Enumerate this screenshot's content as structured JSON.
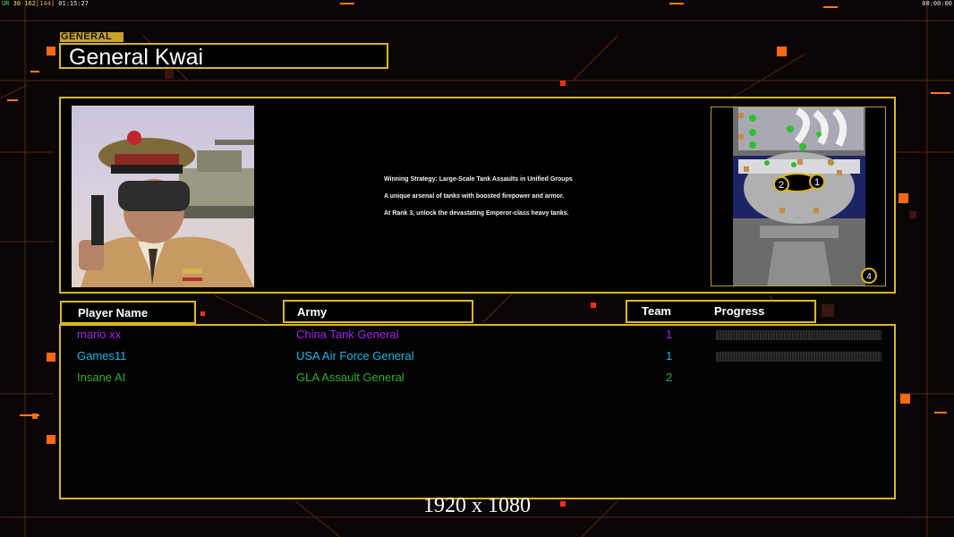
{
  "hud": {
    "ur_label": "UR",
    "fps": "30",
    "frame": "162",
    "avg": "[144]",
    "clock_left": "01:15:27",
    "clock_right": "00:00:00"
  },
  "header": {
    "tag": "GENERAL",
    "general_name": "General Kwai"
  },
  "description": [
    "Winning Strategy: Large-Scale Tank Assaults in Unified Groups",
    "A unique arsenal of tanks with boosted firepower and armor.",
    "At Rank 3, unlock the devastating Emperor-class heavy tanks."
  ],
  "minimap": {
    "start_markers": [
      "1",
      "2",
      "4"
    ]
  },
  "table": {
    "columns": {
      "player_name": "Player Name",
      "army": "Army",
      "team": "Team",
      "progress": "Progress"
    },
    "rows": [
      {
        "player": "mario xx",
        "army": "China Tank General",
        "team": "1",
        "color": "#a020f0",
        "progress": 0.0
      },
      {
        "player": "Games11",
        "army": "USA Air Force General",
        "team": "1",
        "color": "#1fb6e8",
        "progress": 0.0
      },
      {
        "player": "Insane AI",
        "army": "GLA Assault General",
        "team": "2",
        "color": "#2bb02b",
        "progress": null
      }
    ]
  },
  "resolution_label": "1920 x 1080",
  "colors": {
    "frame_gold": "#d8b820",
    "background": "#0b0605",
    "accent_orange": "#ff6a10"
  }
}
